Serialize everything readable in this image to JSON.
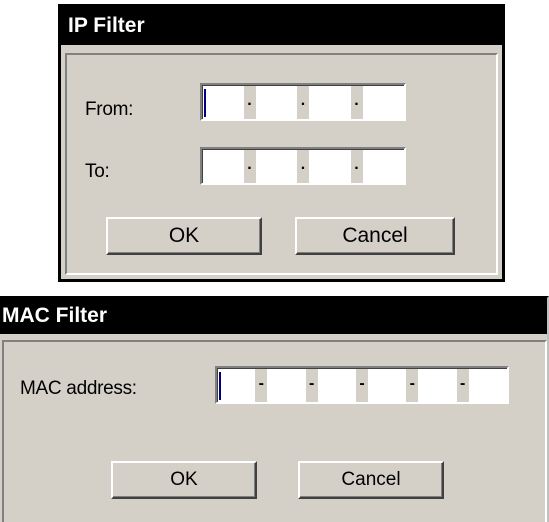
{
  "ip_filter": {
    "title": "IP Filter",
    "from_label": "From:",
    "to_label": "To:",
    "ok_label": "OK",
    "cancel_label": "Cancel",
    "separator": "."
  },
  "mac_filter": {
    "title": "MAC Filter",
    "address_label": "MAC address:",
    "ok_label": "OK",
    "cancel_label": "Cancel",
    "separator": "-"
  }
}
